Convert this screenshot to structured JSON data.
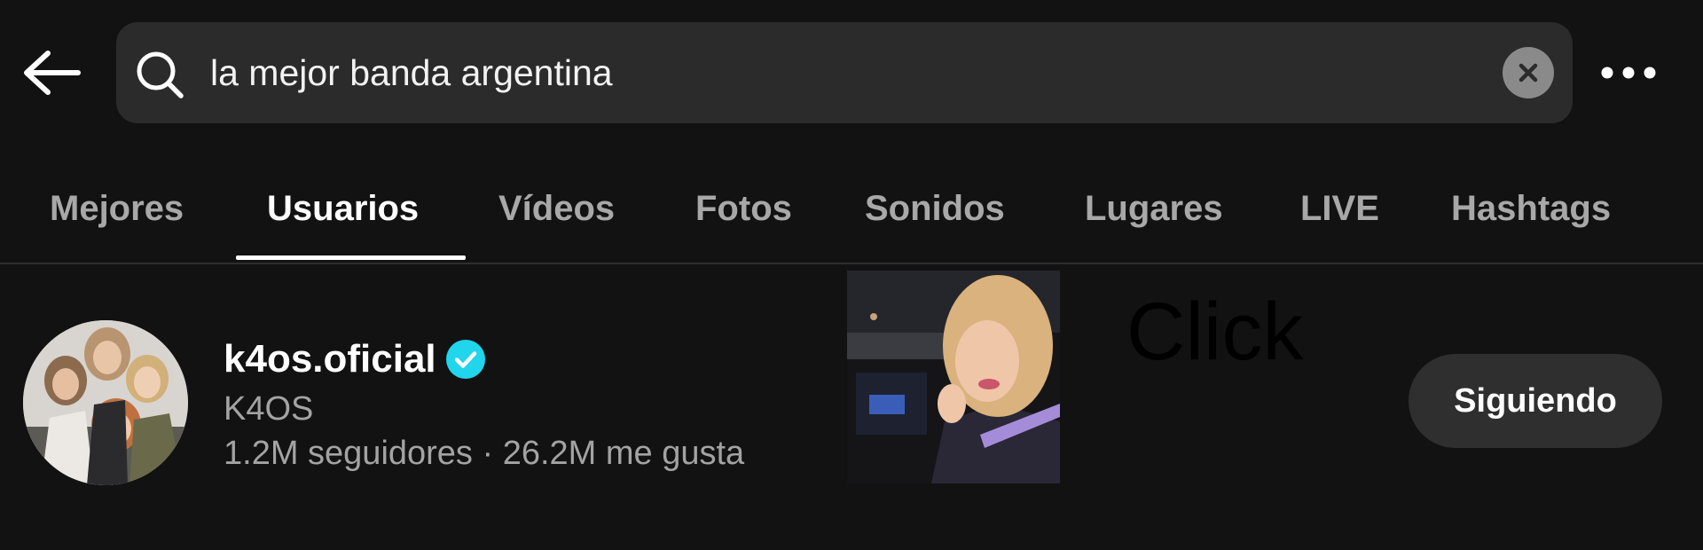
{
  "search": {
    "query": "la mejor banda argentina"
  },
  "tabs": [
    {
      "label": "Mejores",
      "active": false
    },
    {
      "label": "Usuarios",
      "active": true
    },
    {
      "label": "Vídeos",
      "active": false
    },
    {
      "label": "Fotos",
      "active": false
    },
    {
      "label": "Sonidos",
      "active": false
    },
    {
      "label": "Lugares",
      "active": false
    },
    {
      "label": "LIVE",
      "active": false
    },
    {
      "label": "Hashtags",
      "active": false
    }
  ],
  "result": {
    "username": "k4os.oficial",
    "verified": true,
    "display_name": "K4OS",
    "stats": "1.2M seguidores · 26.2M me gusta",
    "follow_label": "Siguiendo"
  },
  "overlay": {
    "text": "Click"
  },
  "icons": {
    "back": "arrow-left-icon",
    "search": "search-icon",
    "clear": "close-circle-icon",
    "more": "more-horizontal-icon",
    "verified": "verified-badge-icon"
  },
  "colors": {
    "background": "#121212",
    "search_bg": "#2b2b2b",
    "verified": "#20d5ec",
    "inactive_tab": "#a8a8a8",
    "button_bg": "#2f2f2f"
  }
}
